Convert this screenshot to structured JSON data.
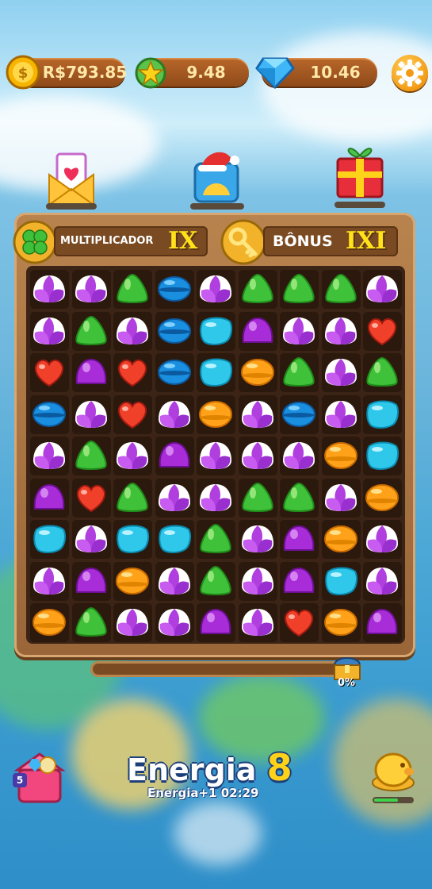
{
  "balance": {
    "money": "R$793.85",
    "stars": "9.48",
    "diamonds": "10.46"
  },
  "board_header": {
    "multiplier_label": "MULTIPLICADOR",
    "multiplier_value": "IX",
    "bonus_label": "BÔNUS",
    "bonus_value": "IXI"
  },
  "progress": {
    "percent_label": "0%",
    "value": 0
  },
  "energy": {
    "title": "Energia",
    "count": "8",
    "timer": "Energia+1 02:29"
  },
  "gift_box": {
    "badge": "5"
  },
  "candy_types": {
    "P": "purple-swirl-candy",
    "G": "green-gumdrop",
    "B": "blue-macaron",
    "C": "cyan-jelly",
    "M": "magenta-drop",
    "O": "orange-macaron",
    "R": "red-heart-candy"
  },
  "grid": [
    [
      "P",
      "P",
      "G",
      "B",
      "P",
      "G",
      "G",
      "G",
      "P"
    ],
    [
      "P",
      "G",
      "P",
      "B",
      "C",
      "M",
      "P",
      "P",
      "R"
    ],
    [
      "R",
      "M",
      "R",
      "B",
      "C",
      "O",
      "G",
      "P",
      "G"
    ],
    [
      "B",
      "P",
      "R",
      "P",
      "O",
      "P",
      "B",
      "P",
      "C"
    ],
    [
      "P",
      "G",
      "P",
      "M",
      "P",
      "P",
      "P",
      "O",
      "C"
    ],
    [
      "M",
      "R",
      "G",
      "P",
      "P",
      "G",
      "G",
      "P",
      "O"
    ],
    [
      "C",
      "P",
      "C",
      "C",
      "G",
      "P",
      "M",
      "O",
      "P"
    ],
    [
      "P",
      "M",
      "O",
      "P",
      "G",
      "P",
      "M",
      "C",
      "P"
    ],
    [
      "O",
      "G",
      "P",
      "P",
      "M",
      "P",
      "R",
      "O",
      "M"
    ]
  ],
  "colors": {
    "wood": "#9a6538",
    "board": "#3b2415",
    "accent": "#ffd21a"
  }
}
